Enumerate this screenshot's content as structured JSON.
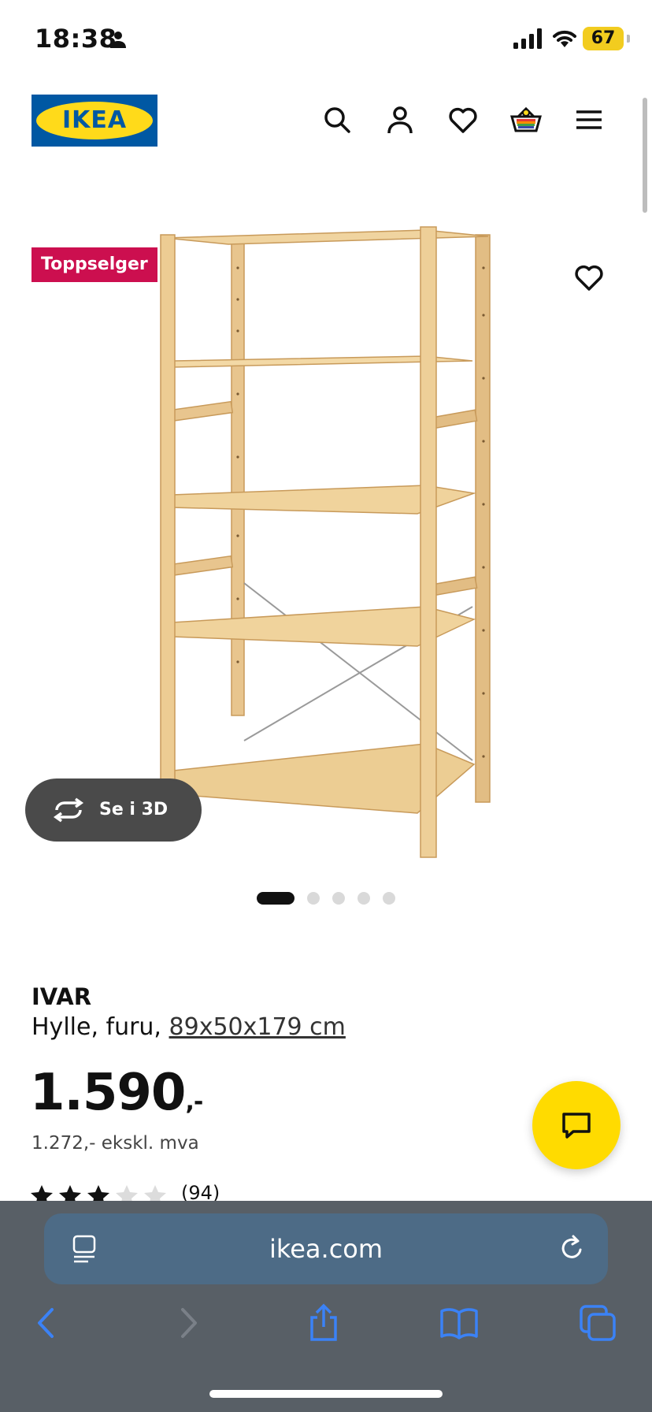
{
  "status_bar": {
    "time": "18:38",
    "battery": "67"
  },
  "header": {
    "logo_text": "IKEA",
    "icons": [
      "search-icon",
      "account-icon",
      "heart-icon",
      "basket-icon",
      "menu-icon"
    ]
  },
  "product": {
    "badge": "Toppselger",
    "view_3d_label": "Se i 3D",
    "image_count": 5,
    "active_image": 1,
    "name": "IVAR",
    "description": "Hylle, furu,",
    "dimensions": "89x50x179 cm",
    "price": "1.590",
    "price_suffix": ",-",
    "price_ex_vat": "1.272,- ekskl. mva",
    "rating": 3,
    "rating_max": 5,
    "review_count": "(94)"
  },
  "browser": {
    "url": "ikea.com"
  },
  "colors": {
    "brand_blue": "#0058a3",
    "brand_yellow": "#ffda1a",
    "badge_red": "#cc0f4f",
    "chat_yellow": "#ffdb00",
    "safari_blue": "#3b82f6"
  }
}
